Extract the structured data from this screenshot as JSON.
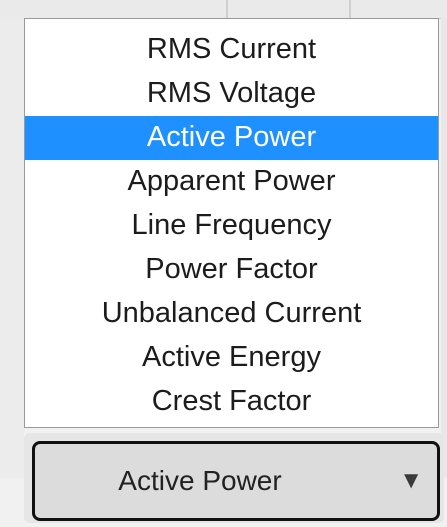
{
  "dropdown": {
    "options": [
      {
        "label": "RMS Current",
        "selected": false
      },
      {
        "label": "RMS Voltage",
        "selected": false
      },
      {
        "label": "Active Power",
        "selected": true
      },
      {
        "label": "Apparent Power",
        "selected": false
      },
      {
        "label": "Line Frequency",
        "selected": false
      },
      {
        "label": "Power Factor",
        "selected": false
      },
      {
        "label": "Unbalanced Current",
        "selected": false
      },
      {
        "label": "Active Energy",
        "selected": false
      },
      {
        "label": "Crest Factor",
        "selected": false
      }
    ],
    "highlight_color": "#1e90ff"
  },
  "select": {
    "value": "Active Power",
    "arrow_icon": "triangle-down-icon"
  }
}
